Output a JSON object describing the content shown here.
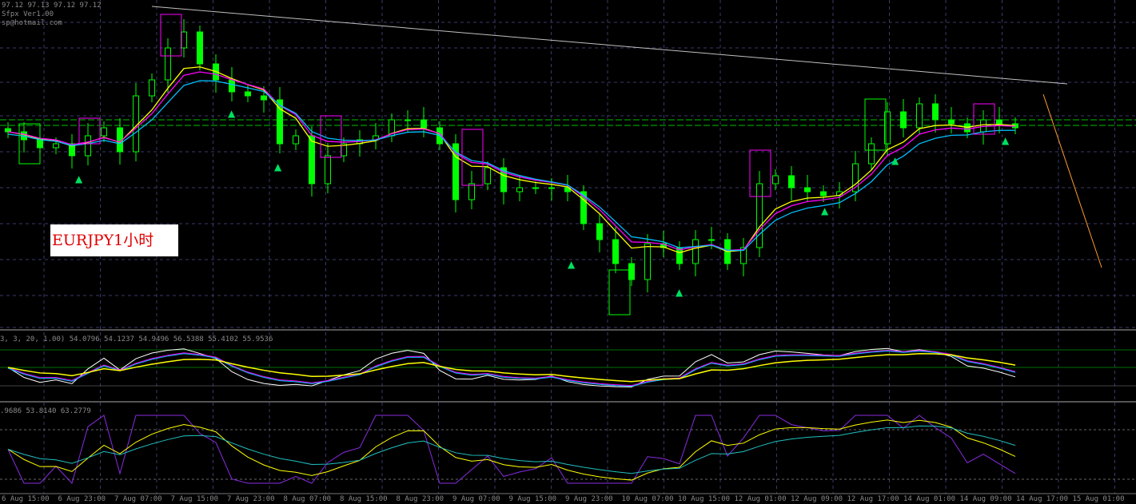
{
  "header": {
    "ohlc": "97.12 97.13 97.12 97.12",
    "indicator_name": "Sfpx Ver1.00",
    "email": "sp@hotmail.com"
  },
  "symbol_label": "EURJPY1小时",
  "indicator1_label": "3, 3, 20, 1.00) 54.0796 54.1237 54.9496 56.5388 55.4102 55.9536",
  "indicator2_label": ".9686 53.8140 63.2779",
  "colors": {
    "bull": "#00ff00",
    "bear": "#00ff00",
    "ma1": "#ff00ff",
    "ma2": "#ffff00",
    "ma3": "#00bfff",
    "trend": "#c0c0c0",
    "orange": "#ff9a30",
    "grid": "#3a3a6a"
  },
  "chart_data": {
    "type": "candlestick",
    "title": "EURJPY H1",
    "ylim": [
      95.95,
      98.0
    ],
    "x_tick_labels": [
      "6 Aug 15:00",
      "6 Aug 23:00",
      "7 Aug 07:00",
      "7 Aug 15:00",
      "7 Aug 23:00",
      "8 Aug 07:00",
      "8 Aug 15:00",
      "8 Aug 23:00",
      "9 Aug 07:00",
      "9 Aug 15:00",
      "9 Aug 23:00",
      "10 Aug 07:00",
      "10 Aug 15:00",
      "12 Aug 01:00",
      "12 Aug 09:00",
      "12 Aug 17:00",
      "14 Aug 01:00",
      "14 Aug 09:00",
      "14 Aug 17:00",
      "15 Aug 01:00"
    ],
    "closes": [
      97.175,
      97.125,
      97.075,
      97.1,
      97.025,
      97.15,
      97.2,
      97.05,
      97.4,
      97.5,
      97.7,
      97.8,
      97.6,
      97.5,
      97.425,
      97.4,
      97.375,
      97.1,
      97.15,
      96.85,
      97.025,
      97.1,
      97.125,
      97.15,
      97.25,
      97.25,
      97.2,
      97.1,
      96.75,
      96.85,
      96.95,
      96.8,
      96.825,
      96.825,
      96.825,
      96.8,
      96.6,
      96.5,
      96.35,
      96.25,
      96.475,
      96.45,
      96.35,
      96.5,
      96.5,
      96.35,
      96.45,
      96.85,
      96.9,
      96.825,
      96.8,
      96.775,
      96.8,
      96.975,
      97.1,
      97.3,
      97.2,
      97.35,
      97.25,
      97.225,
      97.175,
      97.25,
      97.225,
      97.2
    ]
  }
}
